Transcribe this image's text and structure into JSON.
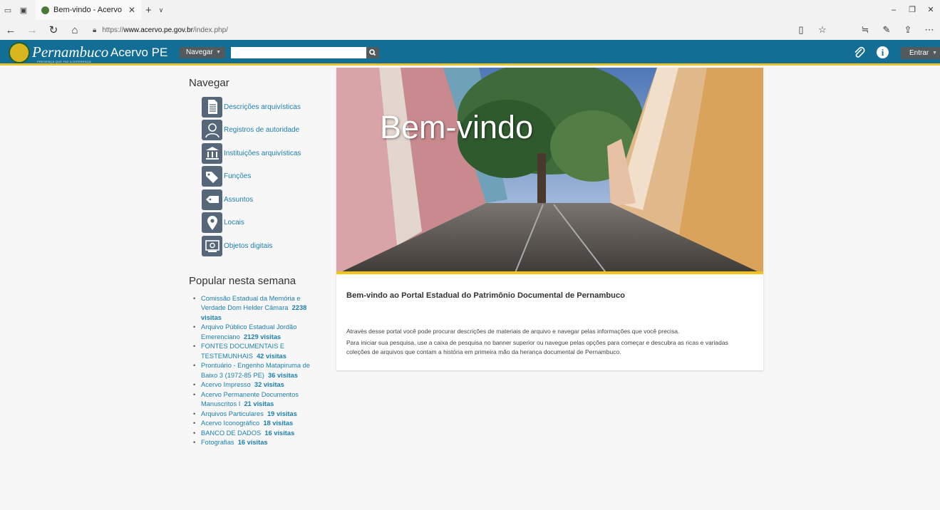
{
  "browser": {
    "tab_title": "Bem-vindo - Acervo PE",
    "url_prefix": "https://",
    "url_domain": "www.acervo.pe.gov.br",
    "url_path": "/index.php/"
  },
  "header": {
    "logo_text": "Pernambuco",
    "logo_tagline": "PRESENÇA QUE FAZ A DIFERENÇA",
    "site_name": "Acervo PE",
    "browse_menu": "Navegar",
    "search_placeholder": "",
    "login_label": "Entrar"
  },
  "sidebar": {
    "browse_title": "Navegar",
    "browse_items": [
      {
        "label": "Descrições arquivísticas",
        "icon": "document-icon"
      },
      {
        "label": "Registros de autoridade",
        "icon": "person-icon"
      },
      {
        "label": "Instituições arquivísticas",
        "icon": "institution-icon"
      },
      {
        "label": "Funções",
        "icon": "tags-icon"
      },
      {
        "label": "Assuntos",
        "icon": "tag-icon"
      },
      {
        "label": "Locais",
        "icon": "map-pin-icon"
      },
      {
        "label": "Objetos digitais",
        "icon": "digital-object-icon"
      }
    ],
    "popular_title": "Popular nesta semana",
    "popular_items": [
      {
        "title": "Comissão Estadual da Memória e Verdade Dom Helder Câmara",
        "count": "2238 visitas"
      },
      {
        "title": "Arquivo Público Estadual Jordão Emerenciano",
        "count": "2129 visitas"
      },
      {
        "title": "FONTES DOCUMENTAIS E TESTEMUNHAIS",
        "count": "42 visitas"
      },
      {
        "title": "Prontuário - Engenho Matapiruma de Baixo 3 (1972-85 PE)",
        "count": "36 visitas"
      },
      {
        "title": "Acervo Impresso",
        "count": "32 visitas"
      },
      {
        "title": "Acervo Permanente Documentos Manuscritos I",
        "count": "21 visitas"
      },
      {
        "title": "Arquivos Particulares",
        "count": "19 visitas"
      },
      {
        "title": "Acervo Iconográfico",
        "count": "18 visitas"
      },
      {
        "title": "BANCO DE DADOS",
        "count": "16 visitas"
      },
      {
        "title": "Fotografias",
        "count": "16 visitas"
      }
    ]
  },
  "main": {
    "banner_title": "Bem-vindo",
    "heading": "Bem-vindo ao Portal Estadual do Patrimônio Documental de Pernambuco",
    "paragraph1": "Através desse portal você pode procurar descrições de materiais de arquivo e navegar pelas informações que você precisa.",
    "paragraph2": "Para iniciar sua pesquisa, use a caixa de pesquisa no banner superior ou navegue pelas opções para começar e descubra as ricas e variadas coleções de arquivos que contam a história em primeira mão da herança documental de Pernambuco."
  },
  "colors": {
    "navbar": "#126e94",
    "accent_yellow": "#f0c419",
    "link": "#1d7fb0",
    "icon_bg": "#56677a"
  }
}
